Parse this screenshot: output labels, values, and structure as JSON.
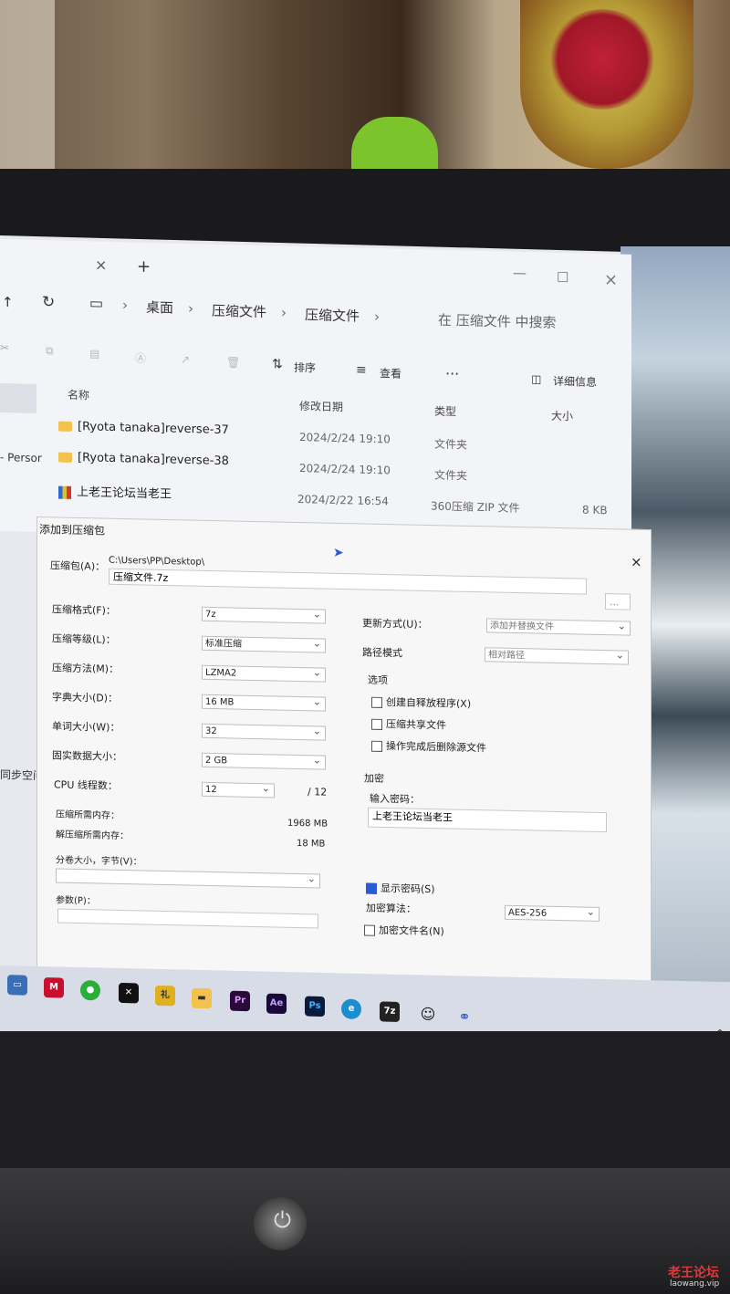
{
  "explorer": {
    "tab_close": "×",
    "tab_add": "+",
    "window_controls": {
      "min": "—",
      "max": "☐",
      "close": "×"
    },
    "breadcrumb": [
      "桌面",
      "压缩文件",
      "压缩文件"
    ],
    "search_placeholder": "在 压缩文件 中搜索",
    "toolbar": {
      "sort": "排序",
      "view": "查看",
      "more": "···",
      "details": "详细信息"
    },
    "columns": {
      "name": "名称",
      "modified": "修改日期",
      "type": "类型",
      "size": "大小"
    },
    "rows": [
      {
        "name": "[Ryota tanaka]reverse-37",
        "modified": "2024/2/24 19:10",
        "type": "文件夹",
        "size": ""
      },
      {
        "name": "[Ryota tanaka]reverse-38",
        "modified": "2024/2/24 19:10",
        "type": "文件夹",
        "size": ""
      },
      {
        "name": "上老王论坛当老王",
        "modified": "2024/2/22 16:54",
        "type": "360压缩 ZIP 文件",
        "size": "8 KB"
      }
    ],
    "sidebar_partial": {
      "persona": "- Persor",
      "sync": "同步空间"
    }
  },
  "dialog": {
    "title": "添加到压缩包",
    "close": "×",
    "archive_label": "压缩包(A)：",
    "archive_path": "C:\\Users\\PP\\Desktop\\",
    "archive_name": "压缩文件.7z",
    "browse": "...",
    "left": {
      "format_label": "压缩格式(F)：",
      "format_value": "7z",
      "level_label": "压缩等级(L)：",
      "level_value": "标准压缩",
      "method_label": "压缩方法(M)：",
      "method_value": "LZMA2",
      "dict_label": "字典大小(D)：",
      "dict_value": "16 MB",
      "word_label": "单词大小(W)：",
      "word_value": "32",
      "solid_label": "固实数据大小：",
      "solid_value": "2 GB",
      "threads_label": "CPU 线程数：",
      "threads_value": "12",
      "threads_max": "/ 12",
      "mem_comp_label": "压缩所需内存：",
      "mem_comp_value": "1968 MB",
      "mem_decomp_label": "解压缩所需内存：",
      "mem_decomp_value": "18 MB",
      "split_label": "分卷大小，字节(V)：",
      "params_label": "参数(P)："
    },
    "right": {
      "update_label": "更新方式(U)：",
      "update_value": "添加并替换文件",
      "path_label": "路径模式",
      "path_value": "相对路径",
      "options_label": "选项",
      "opt_sfx": "创建自释放程序(X)",
      "opt_shared": "压缩共享文件",
      "opt_delete": "操作完成后删除源文件",
      "encrypt_label": "加密",
      "password_label": "输入密码：",
      "password_value": "上老王论坛当老王",
      "show_password": "显示密码(S)",
      "enc_method_label": "加密算法：",
      "enc_method_value": "AES-256",
      "enc_filenames": "加密文件名(N)"
    }
  },
  "taskbar": {
    "icons": [
      "monitor-icon",
      "mcafee-icon",
      "wechat-icon",
      "capcut-icon",
      "app-icon",
      "explorer-icon",
      "premiere-icon",
      "aftereffects-icon",
      "photoshop-icon",
      "edge-icon",
      "7zip-icon",
      "qq-icon",
      "network-icon"
    ],
    "labels": {
      "premiere": "Pr",
      "aftereffects": "Ae",
      "photoshop": "Ps",
      "sevenzip": "7z"
    },
    "tray_chevron": "^"
  },
  "watermark": {
    "name": "老王论坛",
    "url": "laowang.vip"
  },
  "colors": {
    "accent": "#2a5bd7",
    "folder": "#f2c14e",
    "watermark": "#d93a3a"
  }
}
